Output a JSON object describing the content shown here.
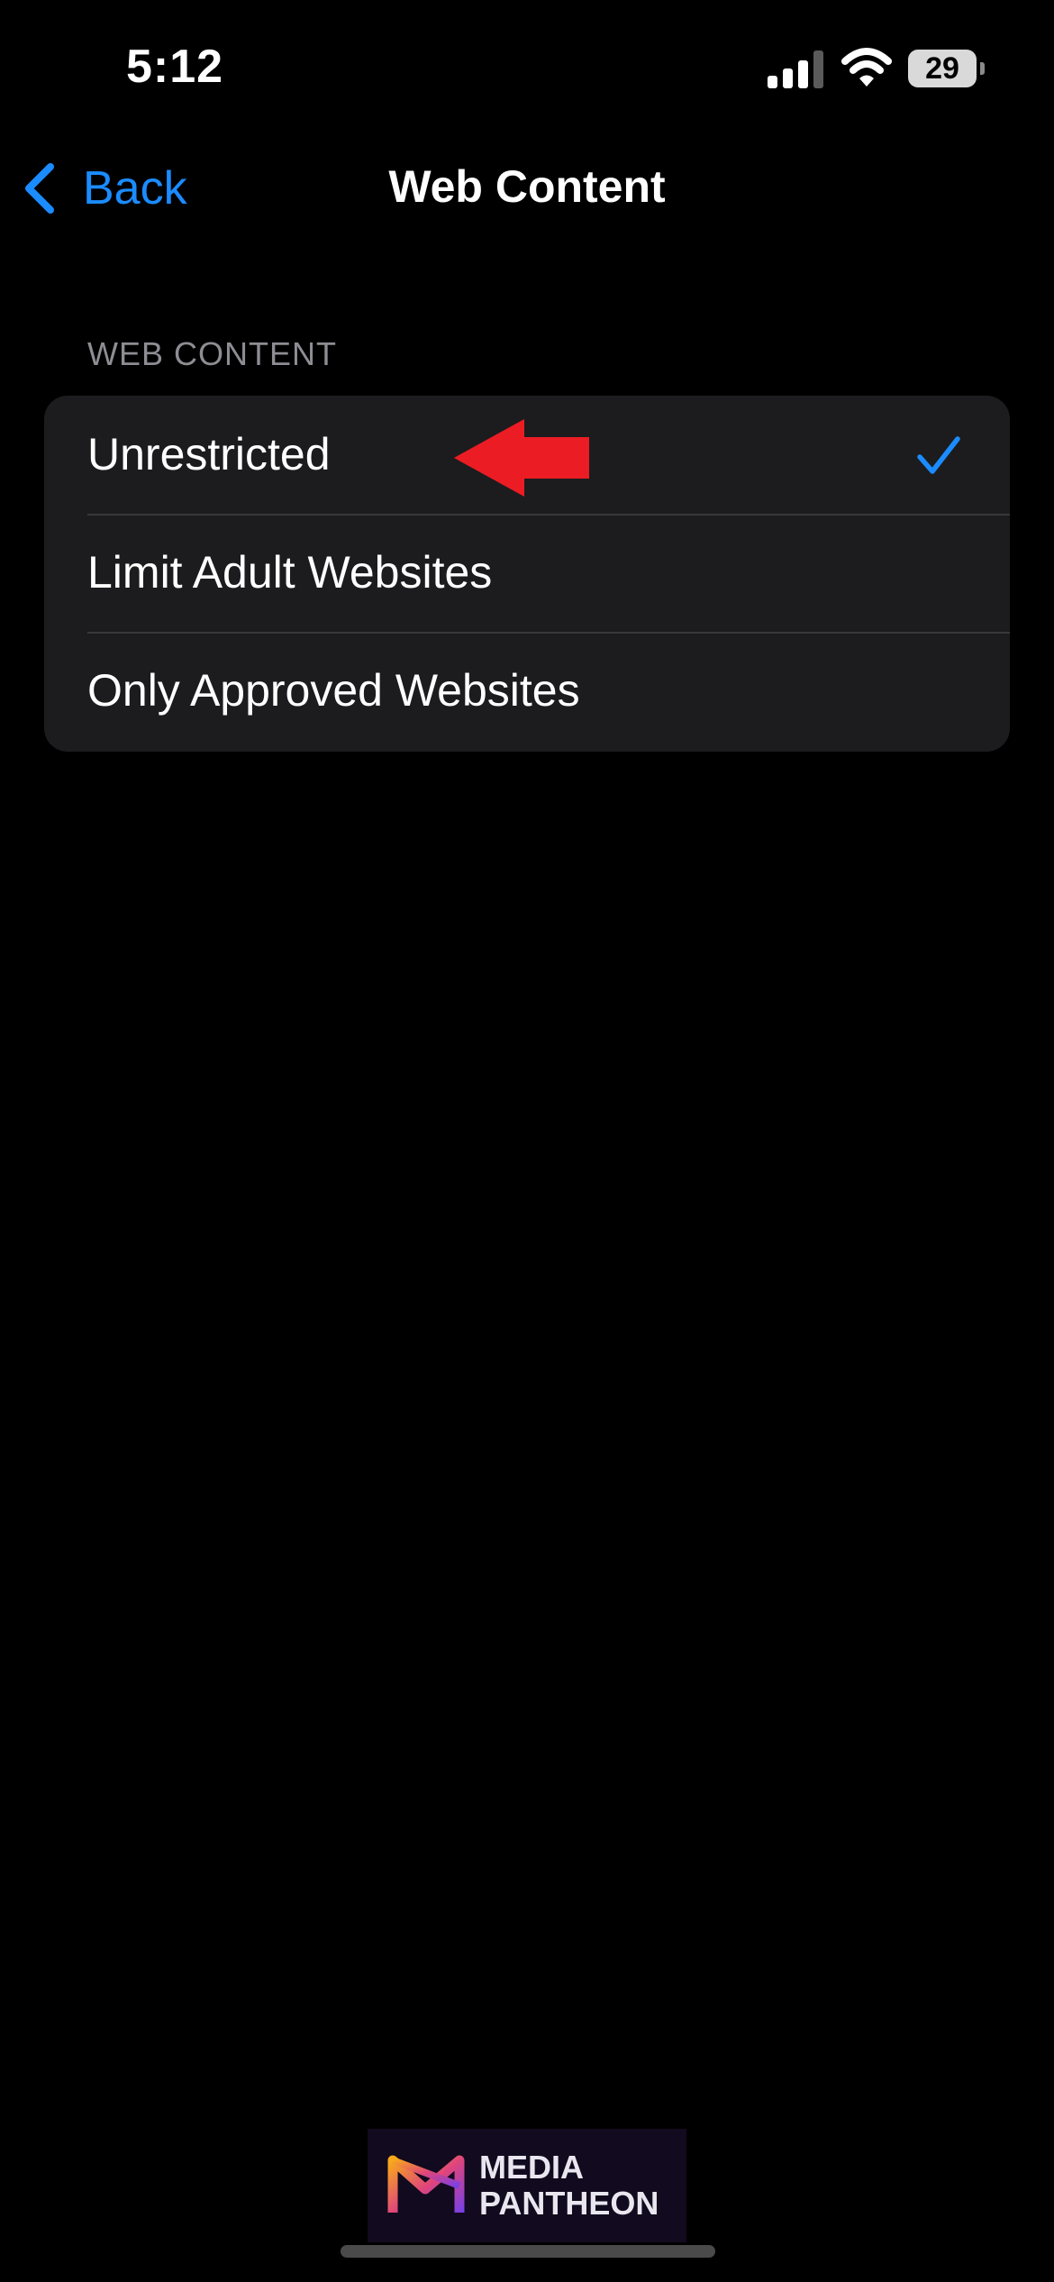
{
  "status_bar": {
    "time": "5:12",
    "battery_level": "29",
    "signal_icon": "cellular-signal-icon",
    "wifi_icon": "wifi-icon"
  },
  "nav": {
    "back_label": "Back",
    "title": "Web Content",
    "back_icon": "chevron-left-icon"
  },
  "section": {
    "header": "WEB CONTENT",
    "options": [
      {
        "label": "Unrestricted",
        "selected": true
      },
      {
        "label": "Limit Adult Websites",
        "selected": false
      },
      {
        "label": "Only Approved Websites",
        "selected": false
      }
    ]
  },
  "watermark": {
    "line1": "MEDIA",
    "line2": "PANTHEON"
  },
  "colors": {
    "background": "#000000",
    "group_background": "#1c1c1e",
    "accent": "#1b8cff",
    "separator": "#38383a",
    "section_header": "#8d8d93",
    "annotation_arrow": "#ec1c24"
  }
}
